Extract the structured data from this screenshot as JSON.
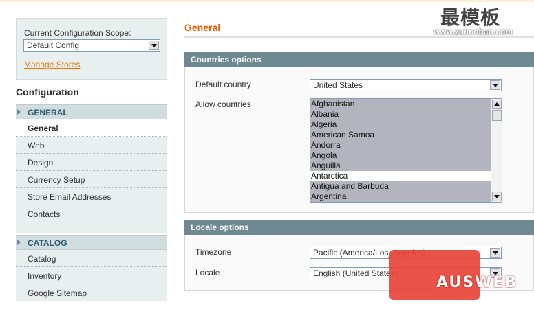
{
  "scope": {
    "label": "Current Configuration Scope:",
    "selected": "Default Config",
    "manage_link": "Manage Stores"
  },
  "sidebar": {
    "title": "Configuration",
    "sections": [
      {
        "label": "GENERAL",
        "items": [
          "General",
          "Web",
          "Design",
          "Currency Setup",
          "Store Email Addresses",
          "Contacts"
        ],
        "active": "General"
      },
      {
        "label": "CATALOG",
        "items": [
          "Catalog",
          "Inventory",
          "Google Sitemap"
        ]
      }
    ]
  },
  "main": {
    "page_title": "General",
    "countries": {
      "title": "Countries options",
      "default_country_label": "Default country",
      "default_country_value": "United States",
      "allow_countries_label": "Allow countries",
      "countries_list": [
        "Afghanistan",
        "Albania",
        "Algeria",
        "American Samoa",
        "Andorra",
        "Angola",
        "Anguilla",
        "Antarctica",
        "Antigua and Barbuda",
        "Argentina"
      ],
      "unselected": "Antarctica"
    },
    "locale": {
      "title": "Locale options",
      "timezone_label": "Timezone",
      "timezone_value": "Pacific (America/Los_Angeles)",
      "locale_label": "Locale",
      "locale_value": "English (United States)"
    }
  },
  "watermarks": {
    "cn_text": "最模板",
    "url_text": "www.zuimoban.com",
    "brand_text": "AUSWEB"
  },
  "colors": {
    "accent_orange": "#eb5e00",
    "section_header": "#6f8992",
    "sidebar_bg": "#e7efef",
    "listbox_selected": "#b4b4bf"
  }
}
